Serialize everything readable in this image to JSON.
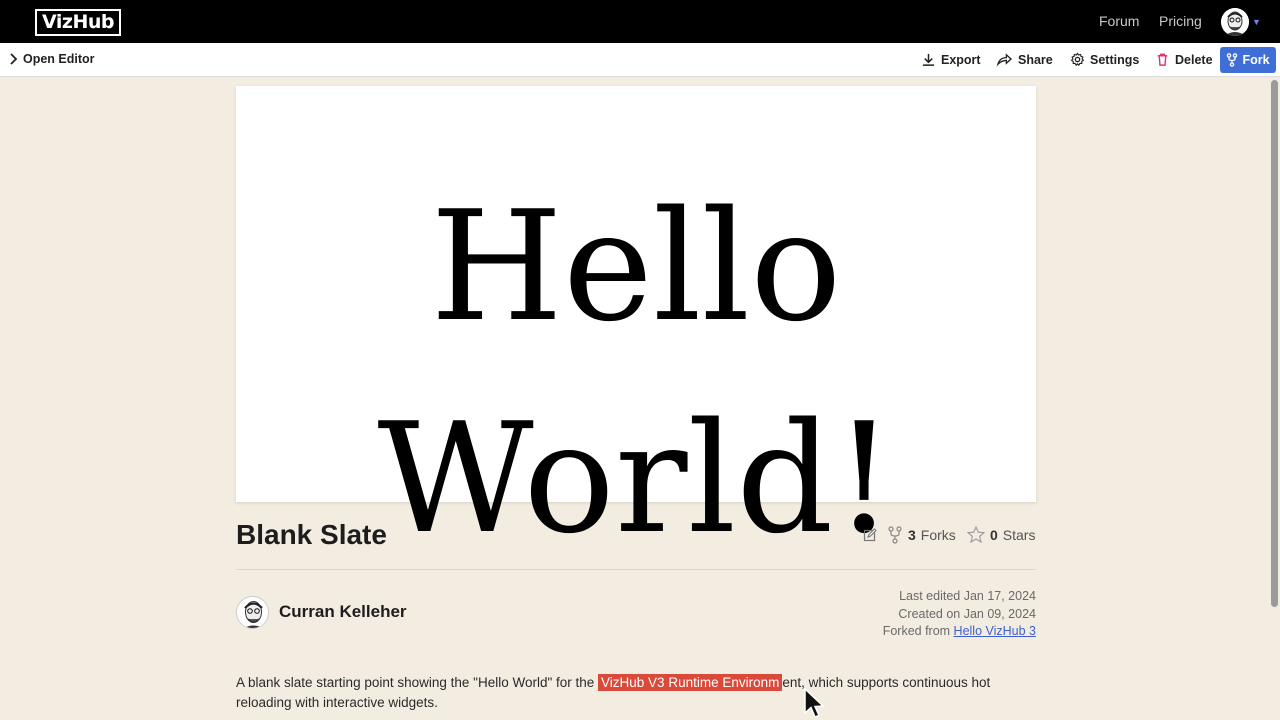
{
  "app": {
    "logo": "VizHub"
  },
  "nav": {
    "forum": "Forum",
    "pricing": "Pricing"
  },
  "toolbar": {
    "open_editor": "Open Editor",
    "export": "Export",
    "share": "Share",
    "settings": "Settings",
    "delete": "Delete",
    "fork": "Fork"
  },
  "preview": {
    "line1": "Hello",
    "line2": "World!"
  },
  "viz": {
    "title": "Blank Slate",
    "forks_count": "3",
    "forks_label": "Forks",
    "stars_count": "0",
    "stars_label": "Stars"
  },
  "author": {
    "name": "Curran Kelleher"
  },
  "meta": {
    "last_edited": "Last edited Jan 17, 2024",
    "created": "Created on Jan 09, 2024",
    "forked_from_prefix": "Forked from ",
    "forked_from_link": "Hello VizHub 3"
  },
  "description": {
    "before": "A blank slate starting point showing the \"Hello World\" for the ",
    "highlighted": "VizHub V3 Runtime Environm",
    "after": "ent, which supports continuous hot reloading with interactive widgets."
  },
  "colors": {
    "accent": "#3f6fd6",
    "highlight": "#d94a3a",
    "background": "#f3ece0"
  }
}
